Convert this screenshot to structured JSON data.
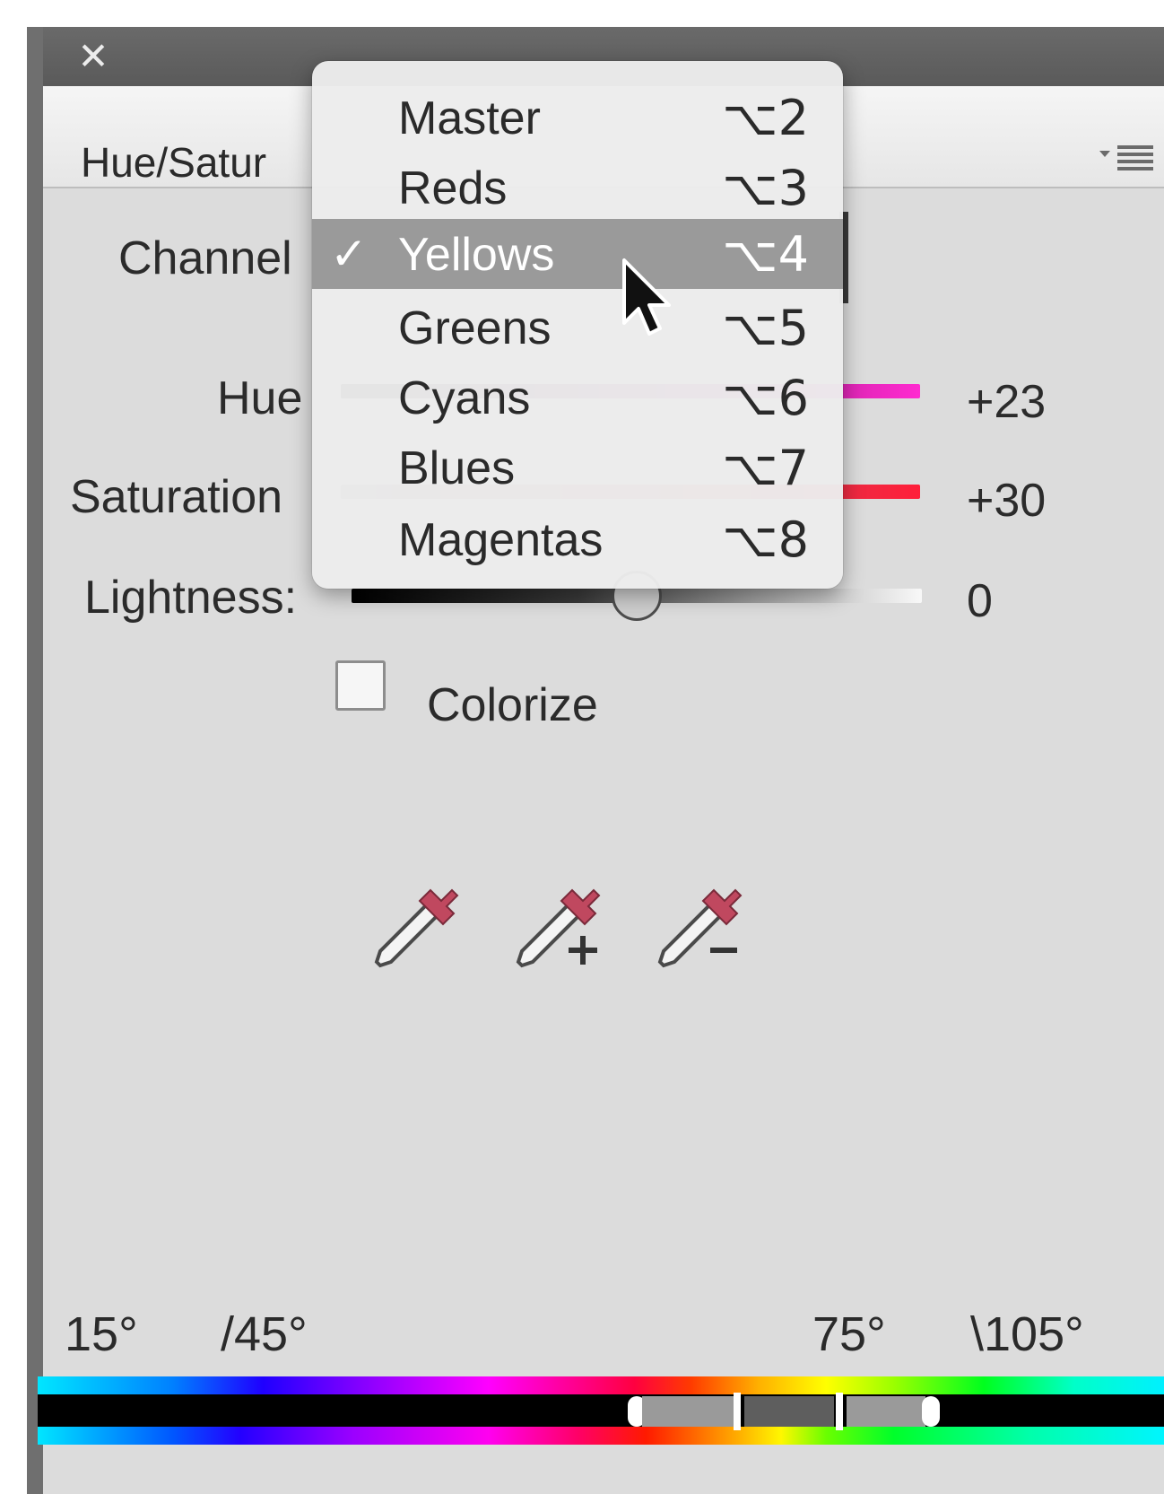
{
  "window": {
    "close_symbol": "✕",
    "tab_title": "Hue/Satur"
  },
  "labels": {
    "channel": "Channel",
    "hue": "Hue",
    "saturation": "Saturation",
    "lightness": "Lightness:"
  },
  "values": {
    "hue": "+23",
    "saturation": "+30",
    "lightness": "0"
  },
  "colorize": {
    "label": "Colorize",
    "checked": false
  },
  "eyedroppers": [
    {
      "icon": "eyedropper-icon"
    },
    {
      "icon": "eyedropper-plus-icon"
    },
    {
      "icon": "eyedropper-minus-icon"
    }
  ],
  "range": {
    "labels": [
      "15°",
      "/45°",
      "75°",
      "\\105°"
    ]
  },
  "channel_menu": {
    "selected": "Yellows",
    "check_symbol": "✓",
    "items": [
      {
        "label": "Master",
        "shortcut": "⌥2"
      },
      {
        "label": "Reds",
        "shortcut": "⌥3"
      },
      {
        "label": "Yellows",
        "shortcut": "⌥4"
      },
      {
        "label": "Greens",
        "shortcut": "⌥5"
      },
      {
        "label": "Cyans",
        "shortcut": "⌥6"
      },
      {
        "label": "Blues",
        "shortcut": "⌥7"
      },
      {
        "label": "Magentas",
        "shortcut": "⌥8"
      }
    ]
  },
  "colors": {
    "panel_bg": "#dcdcdc",
    "titlebar": "#5a5a5a",
    "menu_highlight": "#9a9a9a",
    "hue_track": "#ff2bd0",
    "saturation_track": "#ff1f3a",
    "eyedropper_cap": "#c0485f"
  }
}
